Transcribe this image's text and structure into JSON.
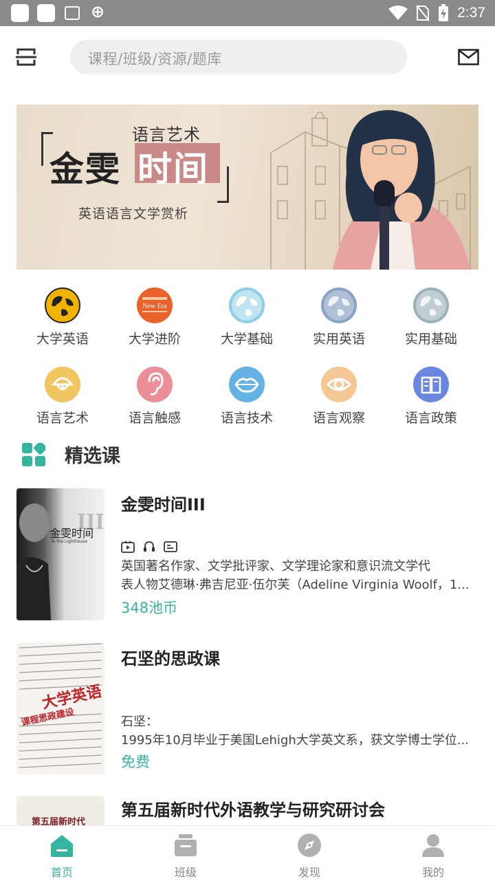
{
  "status_bar": {
    "time": "2:37"
  },
  "search": {
    "placeholder": "课程/班级/资源/题库"
  },
  "banner": {
    "subtitle": "语言艺术",
    "title_part1": "金雯",
    "title_part2": "时间",
    "caption": "英语语言文学赏析"
  },
  "categories": [
    {
      "label": "大学英语",
      "icon": "globe-icon",
      "color": "#f0b400"
    },
    {
      "label": "大学进阶",
      "icon": "book-cover-icon",
      "color": "#e8622a"
    },
    {
      "label": "大学基础",
      "icon": "globe-icon",
      "color": "#8fcde6"
    },
    {
      "label": "实用英语",
      "icon": "globe-icon",
      "color": "#8aa3c4"
    },
    {
      "label": "实用基础",
      "icon": "globe-icon",
      "color": "#9bb0b8"
    },
    {
      "label": "语言艺术",
      "icon": "mouth-icon",
      "color": "#f1c660"
    },
    {
      "label": "语言触感",
      "icon": "ear-icon",
      "color": "#ec8e98"
    },
    {
      "label": "语言技术",
      "icon": "lips-icon",
      "color": "#64b1e3"
    },
    {
      "label": "语言观察",
      "icon": "eye-icon",
      "color": "#f3c894"
    },
    {
      "label": "语言政策",
      "icon": "book-icon",
      "color": "#6987e0"
    }
  ],
  "featured": {
    "title": "精选课",
    "courses": [
      {
        "title": "金雯时间III",
        "thumb_text": "金雯时间",
        "thumb_numeral": "III",
        "thumb_sub": "To the Lighthouse",
        "desc_line1": "英国著名作家、文学批评家、文学理论家和意识流文学代",
        "desc_line2": "表人物艾德琳·弗吉尼亚·伍尔芙（Adeline Virginia Woolf，1...",
        "price": "348池币"
      },
      {
        "title": "石坚的思政课",
        "thumb_title": "大学英语",
        "thumb_sub": "课程思政建设",
        "desc_line1": "石坚：",
        "desc_line2": "1995年10月毕业于美国Lehigh大学英文系，获文学博士学位...",
        "price": "免费"
      },
      {
        "title": "第五届新时代外语教学与研究研讨会",
        "thumb_text": "第五届新时代"
      }
    ]
  },
  "bottom_nav": [
    {
      "label": "首页",
      "icon": "home-icon",
      "active": true
    },
    {
      "label": "班级",
      "icon": "class-icon",
      "active": false
    },
    {
      "label": "发现",
      "icon": "compass-icon",
      "active": false
    },
    {
      "label": "我的",
      "icon": "profile-icon",
      "active": false
    }
  ],
  "colors": {
    "accent": "#35b49f",
    "status_bar": "#8a8a8a"
  }
}
